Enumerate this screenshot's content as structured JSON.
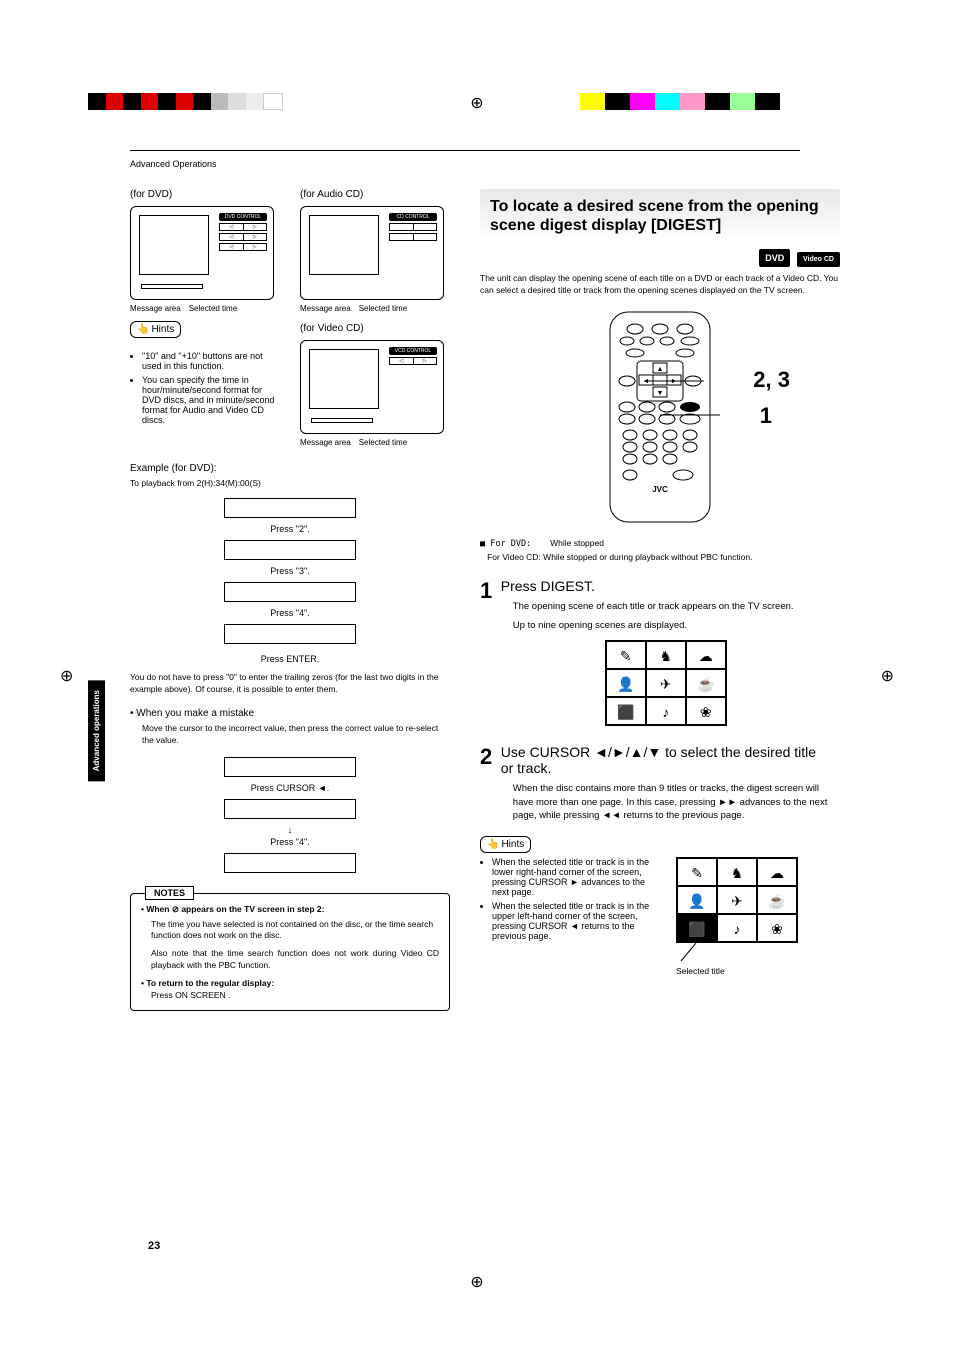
{
  "header": {
    "section": "Advanced Operations"
  },
  "sideTab": "Advanced operations",
  "pageNumber": "23",
  "left": {
    "forDvd": "(for DVD)",
    "forAudio": "(for Audio CD)",
    "forVideo": "(for Video CD)",
    "dvdBadge": "DVD CONTROL",
    "cdBadge": "CD CONTROL",
    "vcdBadge": "VCD CONTROL",
    "capMessage": "Message area",
    "capSelected": "Selected time",
    "hintsLabel": "Hints",
    "hint1": "\"10\" and \"+10\" buttons are not used in this function.",
    "hint2": "You can specify the time in hour/minute/second format for DVD discs, and in minute/second format for Audio and Video CD discs.",
    "exampleTitle": "Example (for DVD):",
    "exampleSub": "To playback from 2(H):34(M):00(S)",
    "press2": "Press \"2\".",
    "press3": "Press \"3\".",
    "press4": "Press \"4\".",
    "pressEnter": "Press ENTER.",
    "para1": "You do not have to press \"0\" to enter the trailing zeros (for the last two digits in the example above). Of course, it is possible to enter them.",
    "mistakeTitle": "When you make a mistake",
    "mistakeText": "Move the cursor to the incorrect value, then press the correct value to re-select the value.",
    "pressCursor": "Press CURSOR ◄.",
    "arrowDown": "↓",
    "notesTitle": "NOTES",
    "noteBullet1": "When ⊘ appears on the TV screen in step 2:",
    "noteText1a": "The time you have selected is not contained on the disc, or the time search function does not work on the disc.",
    "noteText1b": "Also note that the time search function does not work during Video CD playback with the PBC function.",
    "noteBullet2": "To return to the regular display:",
    "noteText2": "Press ON SCREEN ."
  },
  "right": {
    "heading": "To locate a desired scene from the opening scene digest display [DIGEST]",
    "badgeDvd": "DVD",
    "badgeVcd": "Video CD",
    "intro": "The unit can display the opening scene of each title on a DVD or each track of a Video CD.  You can select a desired title or track from the opening scenes displayed on the TV screen.",
    "callout23": "2, 3",
    "callout1": "1",
    "remoteBrand": "JVC",
    "sqForDvd": "■ For DVD:",
    "forDvdCond": "While stopped",
    "forVcdLabel": "For Video CD:",
    "forVcdCond": "While stopped or during playback without PBC function.",
    "step1Title": "Press DIGEST.",
    "step1a": "The opening scene of each title or track appears on the TV screen.",
    "step1b": "Up to nine opening scenes are displayed.",
    "step2Title": "Use CURSOR ◄/►/▲/▼ to select the desired title or track.",
    "step2Text": "When the disc contains more than 9 titles or tracks, the digest screen will have more than one page. In this case, pressing ►► advances to the next page, while pressing ◄◄ returns to the previous page.",
    "hintsLabel": "Hints",
    "hintA": "When the selected title or track is in the lower right-hand corner of the screen, pressing CURSOR ► advances to the next page.",
    "hintB": "When the selected title or track is in the upper left-hand corner of the screen, pressing CURSOR ◄ returns to the previous page.",
    "selectedTitle": "Selected title"
  }
}
